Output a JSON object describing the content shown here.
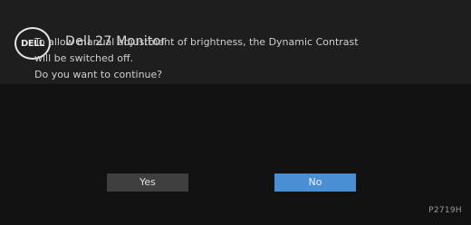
{
  "header": {
    "logo_text": "DELL",
    "title": "Dell 27 Monitor"
  },
  "dialog": {
    "message_lines": [
      "To allow manual adjustment of brightness, the Dynamic Contrast",
      "will be switched off.",
      "Do you want to continue?"
    ],
    "yes_label": "Yes",
    "no_label": "No",
    "selected": "No"
  },
  "footer": {
    "model": "P2719H"
  },
  "colors": {
    "header_bg": "#1e1e1e",
    "body_bg": "#121212",
    "button_default": "#3f3f3f",
    "button_selected": "#4a8fd3"
  }
}
